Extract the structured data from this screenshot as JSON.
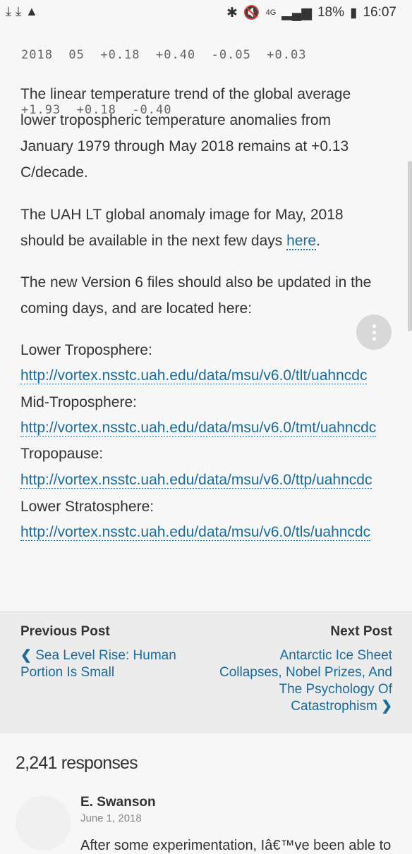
{
  "status_bar": {
    "left_icons": [
      "download-icon",
      "download-icon",
      "warning-icon"
    ],
    "network": "4G",
    "battery": "18%",
    "time": "16:07"
  },
  "data_rows": [
    "2018  05  +0.18  +0.40  -0.05  +0.03",
    "+1.93  +0.18  -0.40"
  ],
  "paragraphs": {
    "p1": "The linear temperature trend of the global average lower tropospheric temperature anomalies from January 1979 through May 2018 remains at +0.13 C/decade.",
    "p2_text": "The UAH LT global anomaly image for May, 2018 should be available in the next few days ",
    "p2_link": "here",
    "p2_end": ".",
    "p3": "The new Version 6 files should also be updated in the coming days, and are located here:"
  },
  "files": [
    {
      "label": "Lower Troposphere:",
      "url": "http://vortex.nsstc.uah.edu/data/msu/v6.0/tlt/uahncdc"
    },
    {
      "label": "Mid-Troposphere:",
      "url": "http://vortex.nsstc.uah.edu/data/msu/v6.0/tmt/uahncdc"
    },
    {
      "label": "Tropopause:",
      "url": "http://vortex.nsstc.uah.edu/data/msu/v6.0/ttp/uahncdc"
    },
    {
      "label": "Lower Stratosphere:",
      "url": "http://vortex.nsstc.uah.edu/data/msu/v6.0/tls/uahncdc"
    }
  ],
  "post_nav": {
    "previous_heading": "Previous Post",
    "previous_title_1": "Sea Level Rise: Human",
    "previous_title_2": "Portion Is Small",
    "next_heading": "Next Post",
    "next_title_1": "Antarctic Ice Sheet",
    "next_title_2": "Collapses, Nobel Prizes, And",
    "next_title_3": "The Psychology Of",
    "next_title_4": "Catastrophism"
  },
  "comments": {
    "count_label": "2,241 responses",
    "first": {
      "author": "E. Swanson",
      "date": "June 1, 2018",
      "text": "After some experimentation, Iâ€™ve been able to"
    }
  },
  "colors": {
    "link": "#1a6b9c",
    "background": "#f7f7f7",
    "nav_background": "#ececec"
  }
}
